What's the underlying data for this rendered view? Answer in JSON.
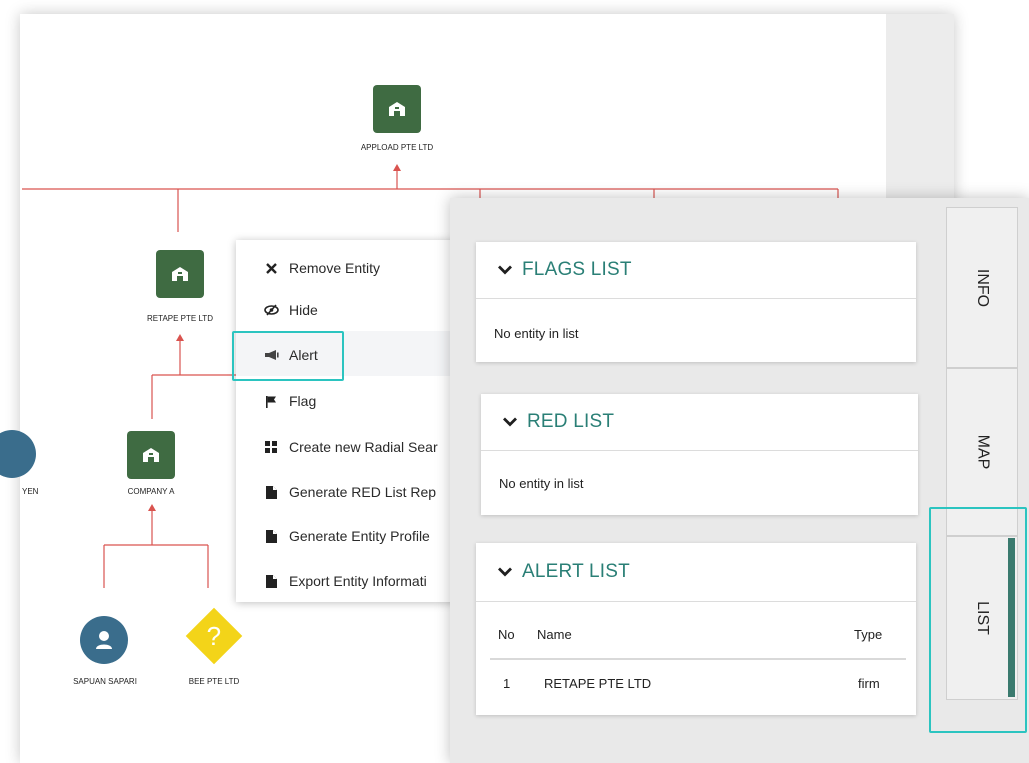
{
  "graph": {
    "nodes": {
      "appload": {
        "label": "APPLOAD PTE LTD",
        "type": "firm-icon"
      },
      "retape": {
        "label": "RETAPE PTE LTD",
        "type": "firm-icon"
      },
      "companyA": {
        "label": "COMPANY A",
        "type": "firm-icon"
      },
      "yen": {
        "label": "YEN",
        "type": "person-icon"
      },
      "sapuan": {
        "label": "SAPUAN SAPARI",
        "type": "person-icon"
      },
      "bee": {
        "label": "BEE PTE LTD",
        "type": "unknown-icon",
        "glyph": "?"
      }
    },
    "edge_color": "#d9534f"
  },
  "context_menu": {
    "items": [
      {
        "label": "Remove Entity",
        "icon": "close-icon"
      },
      {
        "label": "Hide",
        "icon": "eye-slash-icon"
      },
      {
        "label": "Alert",
        "icon": "bullhorn-icon",
        "highlighted": true
      },
      {
        "label": "Flag",
        "icon": "flag-icon"
      },
      {
        "label": "Create new Radial Sear",
        "icon": "grid-icon"
      },
      {
        "label": "Generate RED List Rep",
        "icon": "file-icon"
      },
      {
        "label": "Generate Entity Profile",
        "icon": "file-icon"
      },
      {
        "label": "Export Entity Informati",
        "icon": "file-icon"
      }
    ]
  },
  "lists": {
    "flags": {
      "title": "FLAGS LIST",
      "empty": "No entity in list"
    },
    "red": {
      "title": "RED LIST",
      "empty": "No entity in list"
    },
    "alert": {
      "title": "ALERT LIST",
      "columns": [
        "No",
        "Name",
        "Type"
      ],
      "rows": [
        {
          "no": "1",
          "name": "RETAPE PTE LTD",
          "type": "firm"
        }
      ]
    }
  },
  "tabs": [
    {
      "label": "INFO",
      "active": false
    },
    {
      "label": "MAP",
      "active": false
    },
    {
      "label": "LIST",
      "active": true
    }
  ],
  "colors": {
    "accent": "#2a7f76",
    "highlight_outline": "#2bc4c0",
    "firm_node": "#3f6b42",
    "person_node": "#3a6d8c",
    "unknown_node": "#f3d419"
  }
}
